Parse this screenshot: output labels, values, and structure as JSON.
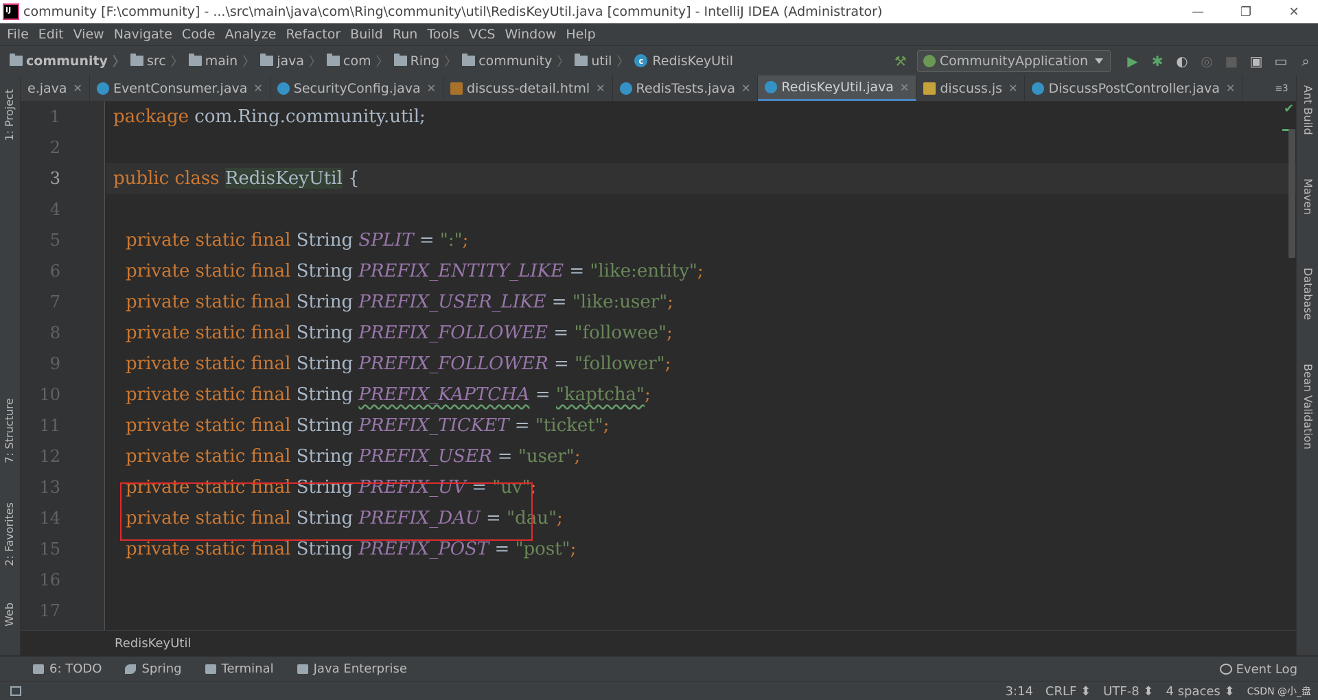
{
  "window": {
    "title": "community [F:\\community] - ...\\src\\main\\java\\com\\Ring\\community\\util\\RedisKeyUtil.java [community] - IntelliJ IDEA (Administrator)",
    "minimize": "—",
    "restore": "❐",
    "close": "✕"
  },
  "menu": [
    "File",
    "Edit",
    "View",
    "Navigate",
    "Code",
    "Analyze",
    "Refactor",
    "Build",
    "Run",
    "Tools",
    "VCS",
    "Window",
    "Help"
  ],
  "breadcrumb": [
    "community",
    "src",
    "main",
    "java",
    "com",
    "Ring",
    "community",
    "util",
    "RedisKeyUtil"
  ],
  "run_config": "CommunityApplication",
  "tabs": [
    {
      "label": "e.java",
      "icon": "class",
      "active": false
    },
    {
      "label": "EventConsumer.java",
      "icon": "class",
      "active": false
    },
    {
      "label": "SecurityConfig.java",
      "icon": "class",
      "active": false
    },
    {
      "label": "discuss-detail.html",
      "icon": "html",
      "active": false
    },
    {
      "label": "RedisTests.java",
      "icon": "class",
      "active": false
    },
    {
      "label": "RedisKeyUtil.java",
      "icon": "class",
      "active": true
    },
    {
      "label": "discuss.js",
      "icon": "js",
      "active": false
    },
    {
      "label": "DiscussPostController.java",
      "icon": "class",
      "active": false
    }
  ],
  "tabs_overflow": "≡3",
  "left_tools": {
    "project": "1: Project",
    "structure": "7: Structure",
    "favorites": "2: Favorites",
    "web": "Web"
  },
  "right_tools": {
    "ant": "Ant Build",
    "maven": "Maven",
    "database": "Database",
    "bean": "Bean Validation"
  },
  "code": {
    "current_line": 3,
    "line_numbers": [
      "1",
      "2",
      "3",
      "4",
      "5",
      "6",
      "7",
      "8",
      "9",
      "10",
      "11",
      "12",
      "13",
      "14",
      "15",
      "16",
      "17"
    ],
    "package_kw": "package",
    "package_name": " com.Ring.community.util;",
    "class_kw": "public class ",
    "class_name": "RedisKeyUtil",
    "class_brace": " {",
    "decl_kw": "private static final",
    "decl_type": " String ",
    "fields": [
      {
        "name": "SPLIT",
        "value": "\":\""
      },
      {
        "name": "PREFIX_ENTITY_LIKE",
        "value": "\"like:entity\""
      },
      {
        "name": "PREFIX_USER_LIKE",
        "value": "\"like:user\""
      },
      {
        "name": "PREFIX_FOLLOWEE",
        "value": "\"followee\""
      },
      {
        "name": "PREFIX_FOLLOWER",
        "value": "\"follower\""
      },
      {
        "name": "PREFIX_KAPTCHA",
        "value": "\"kaptcha\""
      },
      {
        "name": "PREFIX_TICKET",
        "value": "\"ticket\""
      },
      {
        "name": "PREFIX_USER",
        "value": "\"user\""
      },
      {
        "name": "PREFIX_UV",
        "value": "\"uv\""
      },
      {
        "name": "PREFIX_DAU",
        "value": "\"dau\""
      },
      {
        "name": "PREFIX_POST",
        "value": "\"post\""
      }
    ],
    "assign": " = ",
    "semicolon": ";"
  },
  "editor_breadcrumb": "RedisKeyUtil",
  "bottom_tools": [
    "6: TODO",
    "Spring",
    "Terminal",
    "Java Enterprise"
  ],
  "event_log": "Event Log",
  "status": {
    "position": "3:14",
    "line_sep": "CRLF ⬍",
    "encoding": "UTF-8 ⬍",
    "indent": "4 spaces ⬍",
    "watermark": "CSDN @小_盘"
  }
}
